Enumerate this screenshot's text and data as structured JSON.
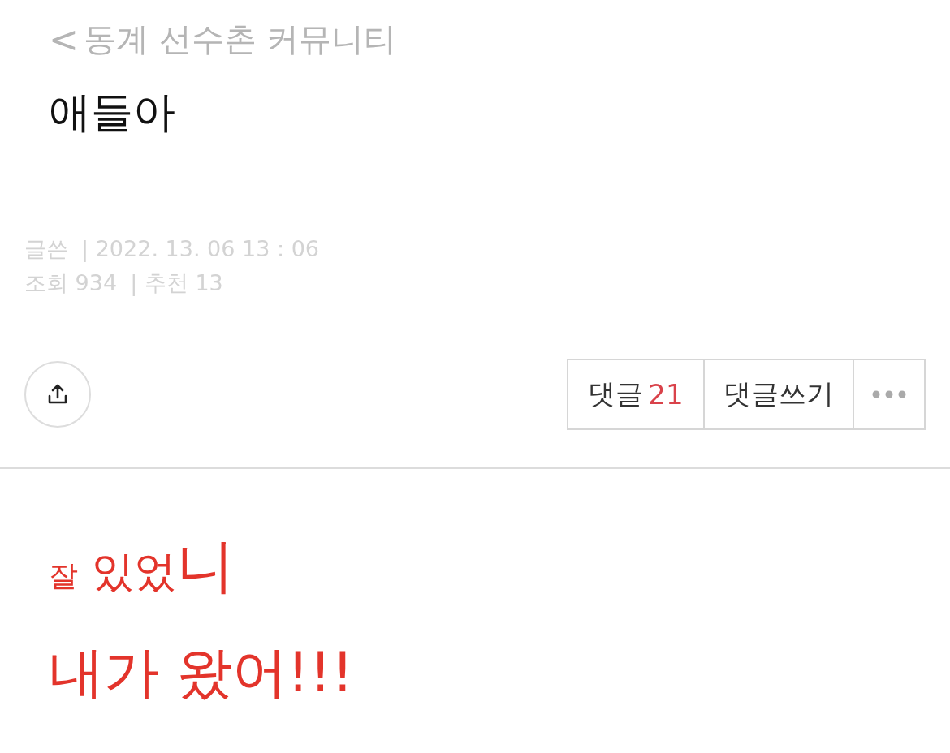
{
  "header": {
    "back_icon": "<",
    "title": "동계 선수촌 커뮤니티"
  },
  "post": {
    "title": "애들아",
    "meta": [
      {
        "label": "글쓴",
        "value": "| 2022. 13. 06 13 : 06"
      },
      {
        "label": "조회 934",
        "value": "| 추천 13"
      }
    ]
  },
  "actions": {
    "comments": {
      "label": "댓글",
      "count": "21"
    },
    "write_comment": "댓글쓰기"
  },
  "body": [
    {
      "segments": [
        {
          "text": "잘",
          "kind": "small"
        },
        {
          "text": " 있었",
          "kind": "medium"
        },
        {
          "text": "니",
          "kind": "large"
        }
      ]
    },
    {
      "segments": [
        {
          "text": "내가 왔어!!!",
          "kind": "xlarge"
        }
      ]
    }
  ]
}
